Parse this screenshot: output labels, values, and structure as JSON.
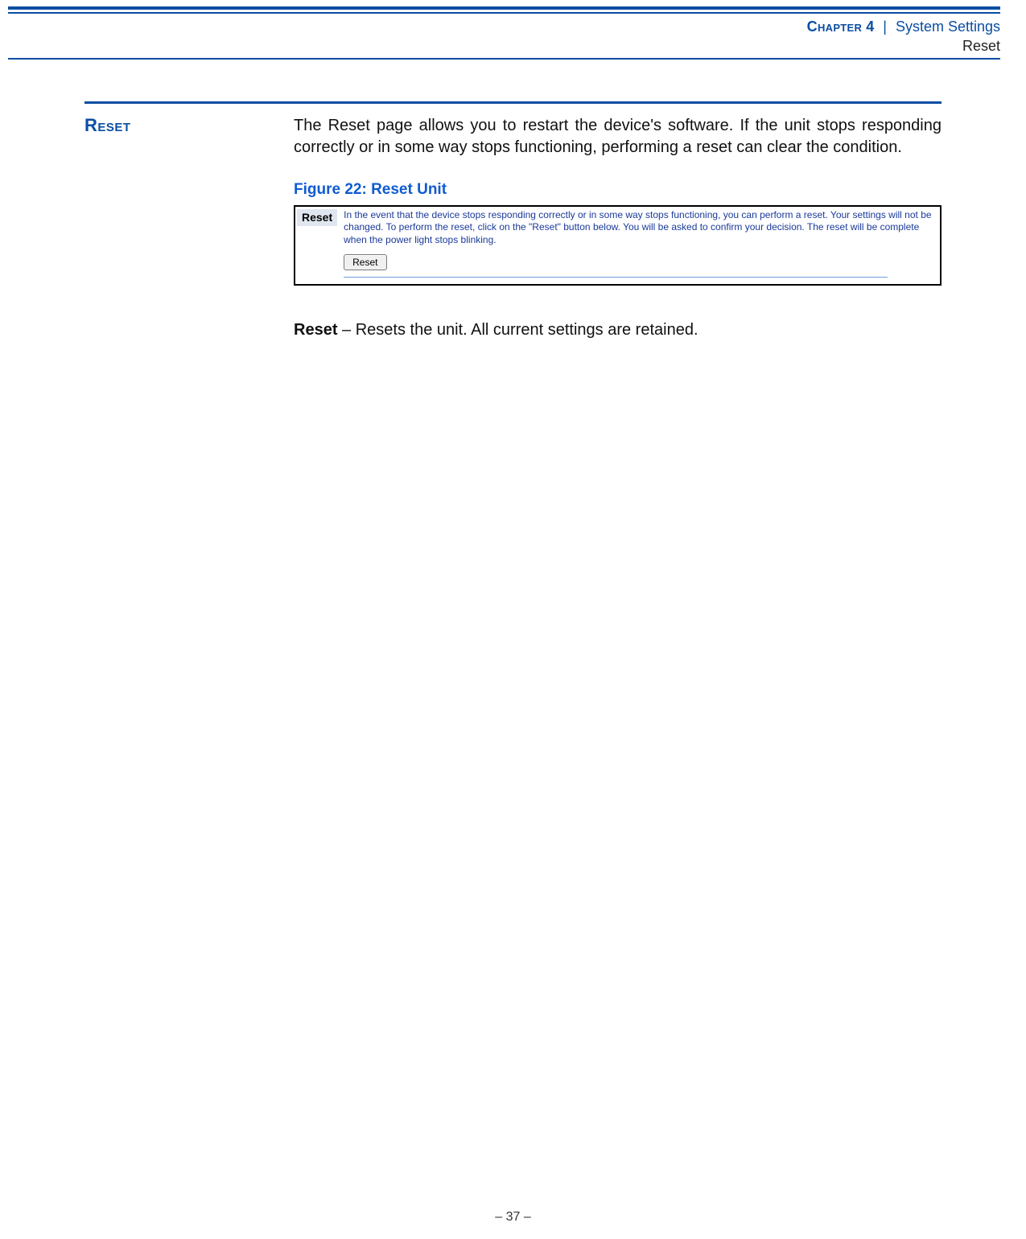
{
  "header": {
    "chapter_prefix": "Chapter",
    "chapter_number": "4",
    "separator": "|",
    "chapter_title": "System Settings",
    "section_name": "Reset"
  },
  "section": {
    "heading": "Reset",
    "intro_paragraph": "The Reset page allows you to restart the device's software. If the unit stops responding correctly or in some way stops functioning, performing a reset can clear the condition."
  },
  "figure": {
    "caption": "Figure 22:  Reset Unit",
    "tab_label": "Reset",
    "description": "In the event that the device stops responding correctly or in some way stops functioning, you can perform a reset. Your settings will not be changed. To perform the reset, click on the \"Reset\" button below. You will be asked to confirm your decision. The reset will be complete when the power light stops blinking.",
    "button_label": "Reset"
  },
  "definition": {
    "term": "Reset",
    "text": " – Resets the unit. All current settings are retained."
  },
  "footer": {
    "page_number": "–  37  –"
  }
}
